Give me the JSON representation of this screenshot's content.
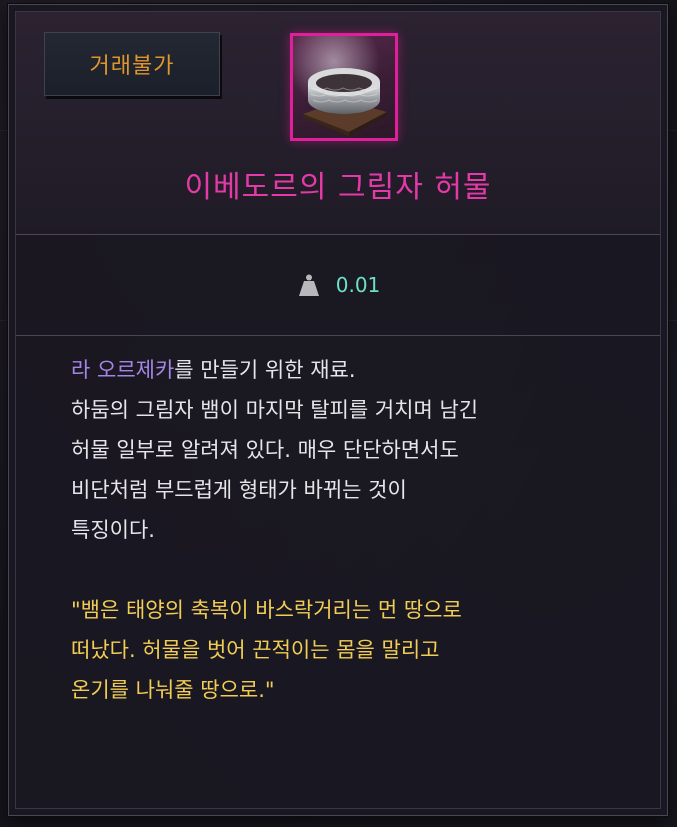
{
  "tooltip": {
    "trade_status": "거래불가",
    "item_name": "이베도르의 그림자 허물",
    "rarity_color": "#e0209a",
    "weight_icon": "weight-icon",
    "weight": "0.01",
    "description": {
      "line1_highlight": "라 오르제카",
      "line1_rest": "를 만들기 위한 재료.",
      "line2": "하둠의 그림자 뱀이 마지막 탈피를 거치며 남긴",
      "line3": "허물 일부로 알려져 있다. 매우 단단하면서도",
      "line4": "비단처럼 부드럽게 형태가 바뀌는 것이",
      "line5": "특징이다."
    },
    "quote": {
      "line1": "\"뱀은 태양의 축복이 바스락거리는 먼 땅으로",
      "line2": "떠났다. 허물을 벗어 끈적이는 몸을 말리고",
      "line3": "온기를 나눠줄 땅으로.\""
    }
  }
}
